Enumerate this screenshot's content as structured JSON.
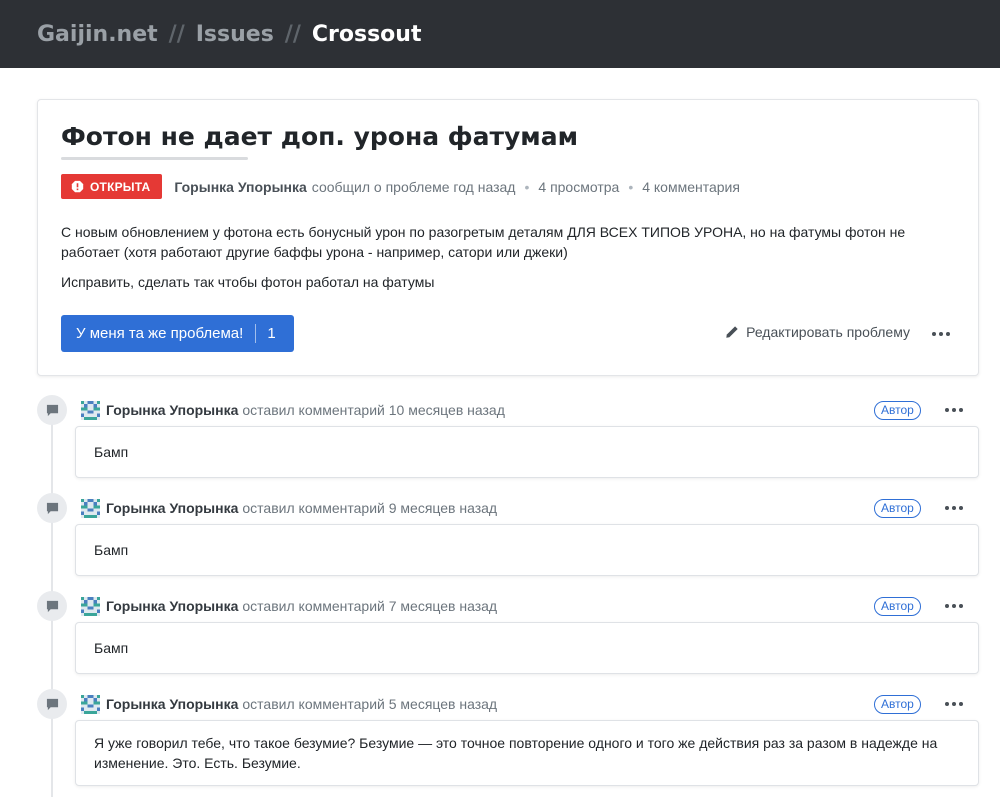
{
  "breadcrumb": {
    "items": [
      "Gaijin.net",
      "Issues",
      "Crossout"
    ],
    "separator": "//"
  },
  "issue": {
    "title": "Фотон не дает доп. урона фатумам",
    "status": "ОТКРЫТА",
    "status_color": "#e53935",
    "author": "Горынка Упорынка",
    "reported_text": "сообщил о проблеме год назад",
    "views": "4 просмотра",
    "comments_count": "4 комментария",
    "description": [
      "С новым обновлением у фотона есть бонусный урон по разогретым деталям ДЛЯ ВСЕХ ТИПОВ УРОНА, но на фатумы фотон не работает (хотя работают другие баффы урона - например, сатори или джеки)",
      "Исправить, сделать так чтобы фотон работал на фатумы"
    ],
    "metoo_label": "У меня та же проблема!",
    "metoo_count": "1",
    "edit_label": "Редактировать проблему",
    "accent_color": "#2f6fd6"
  },
  "comments": [
    {
      "author": "Горынка Упорынка",
      "action": "оставил комментарий 10 месяцев назад",
      "badge": "Автор",
      "body": "Бамп"
    },
    {
      "author": "Горынка Упорынка",
      "action": "оставил комментарий 9 месяцев назад",
      "badge": "Автор",
      "body": "Бамп"
    },
    {
      "author": "Горынка Упорынка",
      "action": "оставил комментарий 7 месяцев назад",
      "badge": "Автор",
      "body": "Бамп"
    },
    {
      "author": "Горынка Упорынка",
      "action": "оставил комментарий 5 месяцев назад",
      "badge": "Автор",
      "body": "Я уже говорил тебе, что такое безумие? Безумие — это точное повторение одного и того же действия раз за разом в надежде на изменение. Это. Есть. Безумие."
    }
  ]
}
